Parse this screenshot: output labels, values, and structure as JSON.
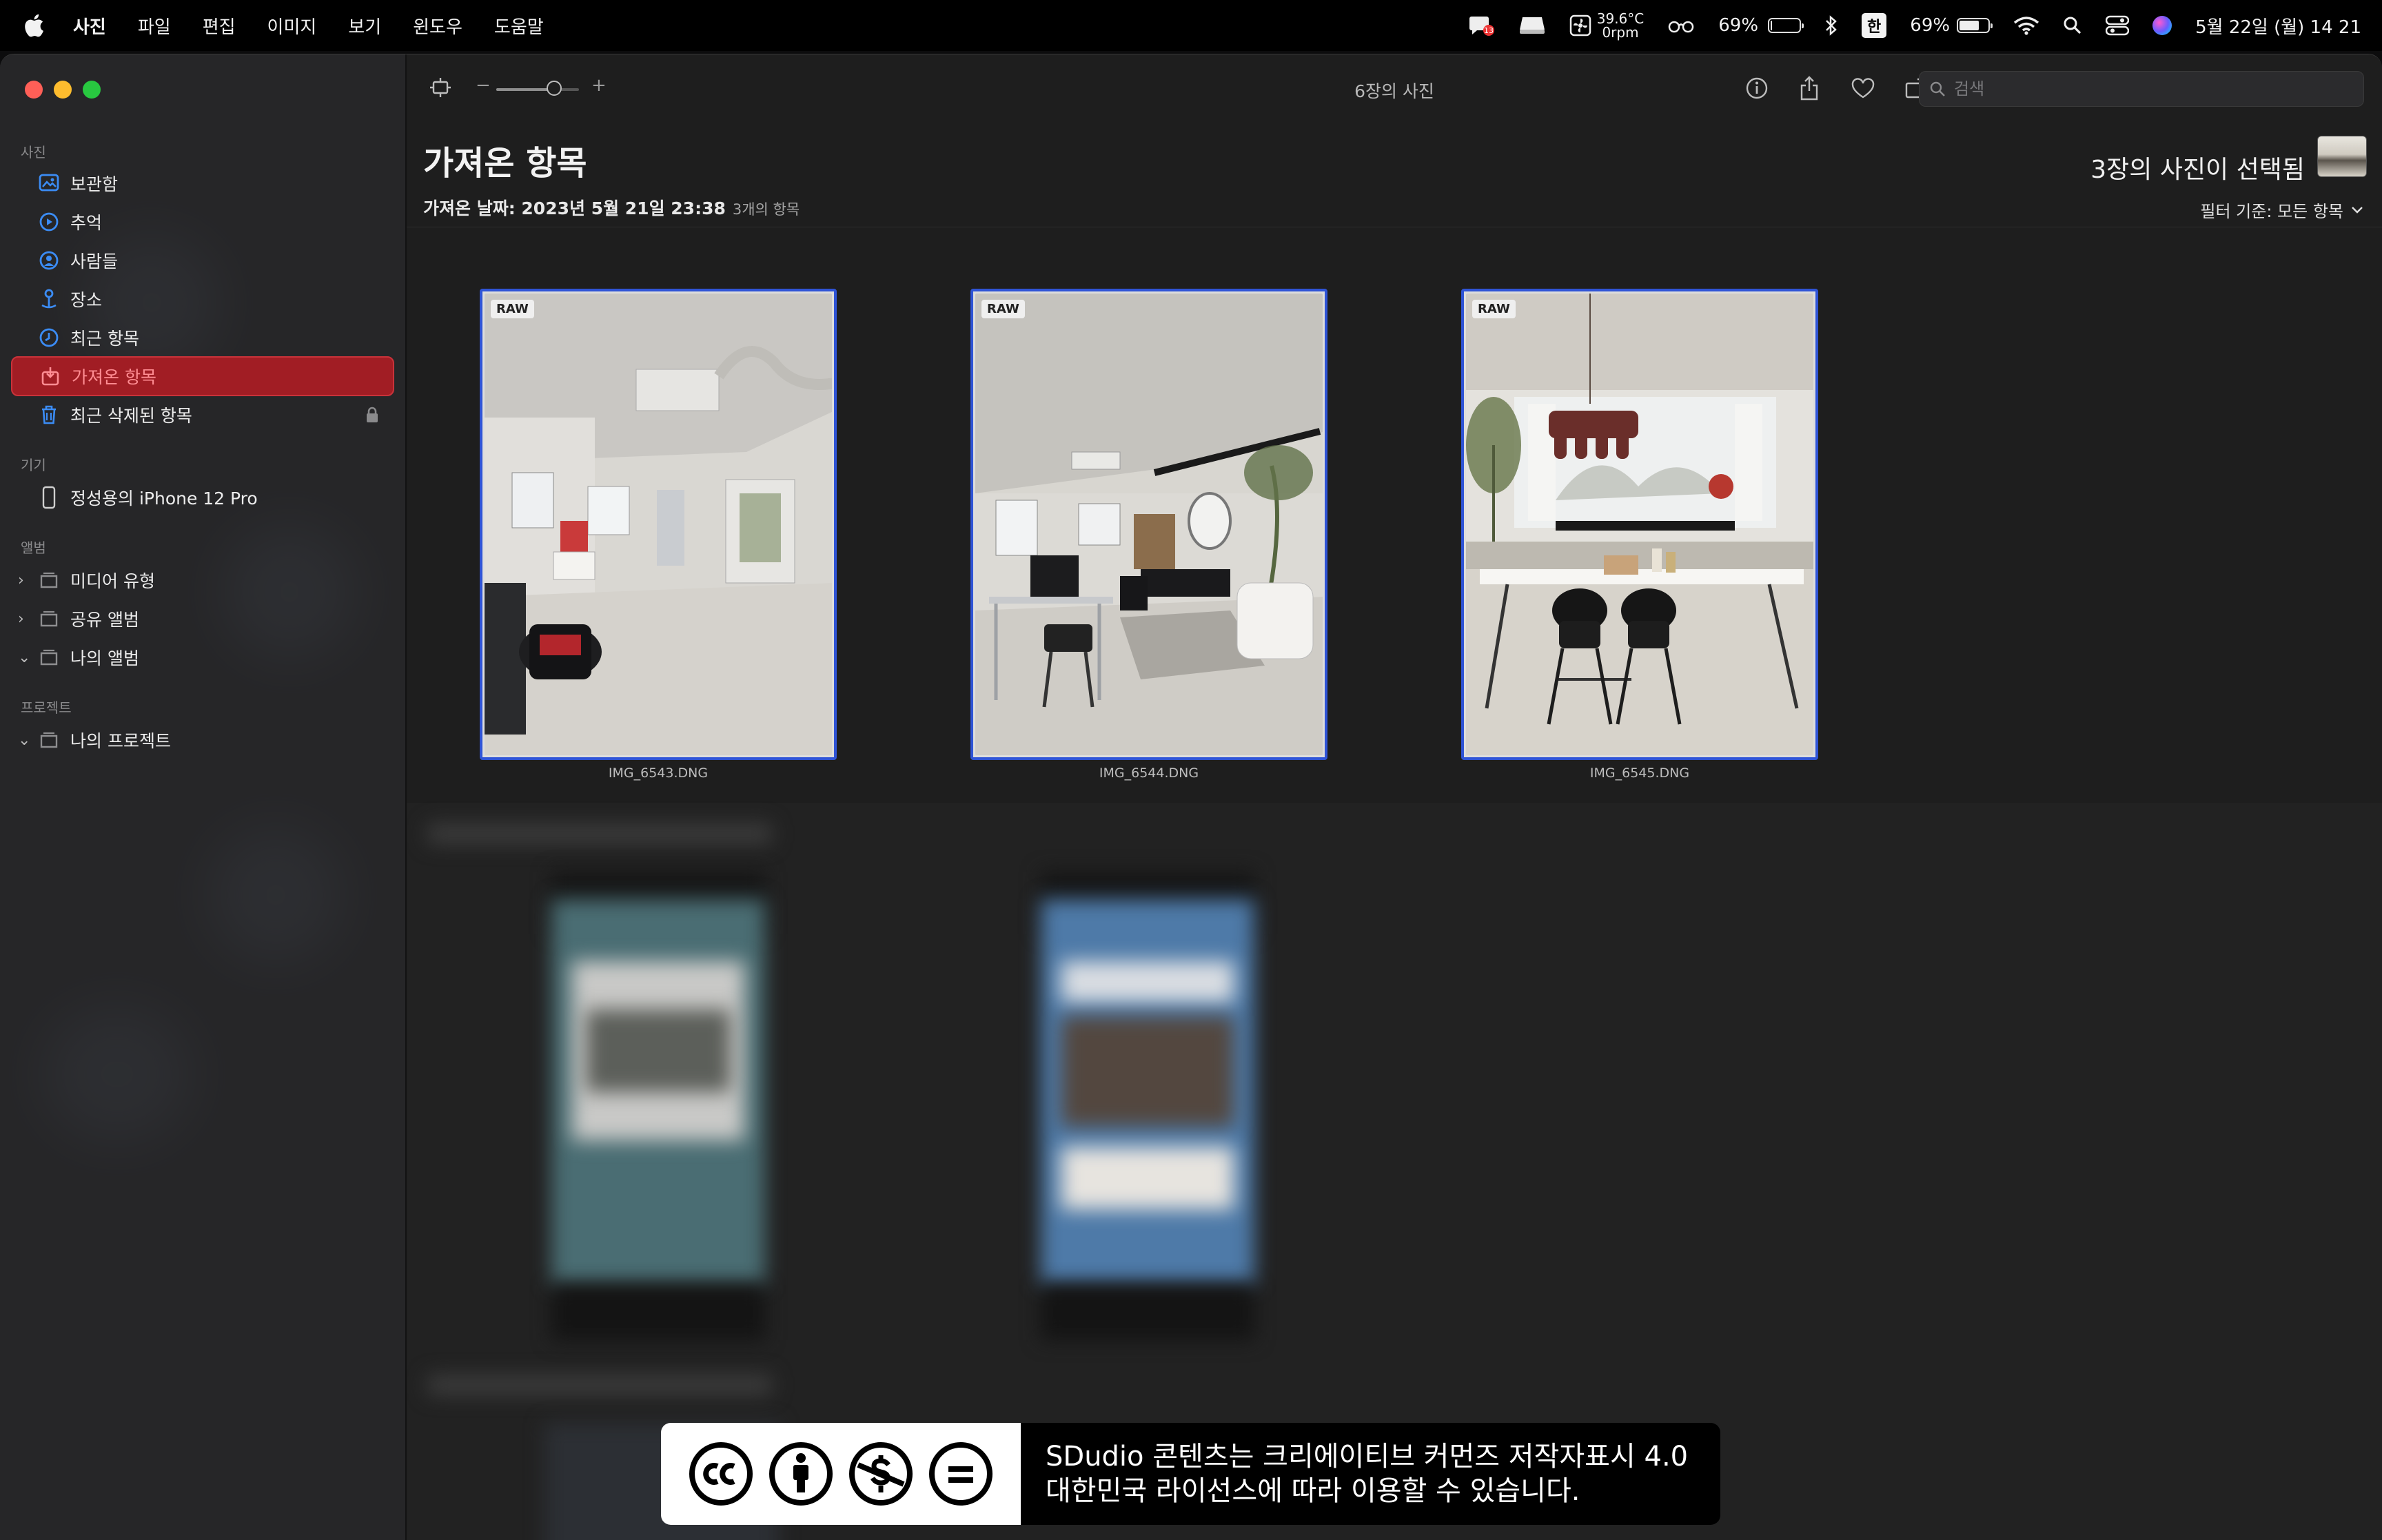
{
  "menubar": {
    "app_name": "사진",
    "items": [
      "파일",
      "편집",
      "이미지",
      "보기",
      "윈도우",
      "도움말"
    ],
    "status": {
      "cpu_temp": "39.6°C",
      "fan": "0rpm",
      "battery_text_1": "69%",
      "input_lang": "한",
      "battery_text_2": "69%",
      "battery_level": 0.69,
      "datetime": "5월 22일 (월) 14 21"
    }
  },
  "sidebar": {
    "sections": {
      "photos": "사진",
      "devices": "기기",
      "albums": "앨범",
      "projects": "프로젝트"
    },
    "library_items": [
      {
        "label": "보관함",
        "icon": "library-icon"
      },
      {
        "label": "추억",
        "icon": "memories-icon"
      },
      {
        "label": "사람들",
        "icon": "people-icon"
      },
      {
        "label": "장소",
        "icon": "places-icon"
      },
      {
        "label": "최근 항목",
        "icon": "recents-icon"
      },
      {
        "label": "가져온 항목",
        "icon": "imports-icon",
        "active": true
      },
      {
        "label": "최근 삭제된 항목",
        "icon": "trash-icon",
        "locked": true
      }
    ],
    "device": "정성용의 iPhone 12 Pro",
    "albums": [
      "미디어 유형",
      "공유 앨범",
      "나의 앨범"
    ],
    "projects": [
      "나의 프로젝트"
    ]
  },
  "toolbar": {
    "title": "6장의 사진",
    "zoom_minus": "−",
    "zoom_plus": "+",
    "zoom_level": 0.7,
    "search_placeholder": "검색"
  },
  "content": {
    "title": "가져온 항목",
    "import_date": "가져온 날짜: 2023년 5월 21일 23:38",
    "import_count": "3개의 항목",
    "selected_count": "3장의 사진이 선택됨",
    "filter_label": "필터 기준: 모든 항목",
    "photos": [
      {
        "badge": "RAW",
        "filename": "IMG_6543.DNG"
      },
      {
        "badge": "RAW",
        "filename": "IMG_6544.DNG"
      },
      {
        "badge": "RAW",
        "filename": "IMG_6545.DNG"
      }
    ]
  },
  "license_banner": {
    "line1": "SDudio 콘텐츠는 크리에이티브 커먼즈 저작자표시 4.0",
    "line2": "대한민국 라이선스에 따라 이용할 수 있습니다.",
    "icons": [
      "cc-icon",
      "attribution-icon",
      "noncommercial-icon",
      "noderivatives-icon"
    ]
  },
  "colors": {
    "accent_selection": "#2f54d6",
    "sidebar_active": "#a11d24",
    "window_bg": "#1e1e1e"
  }
}
